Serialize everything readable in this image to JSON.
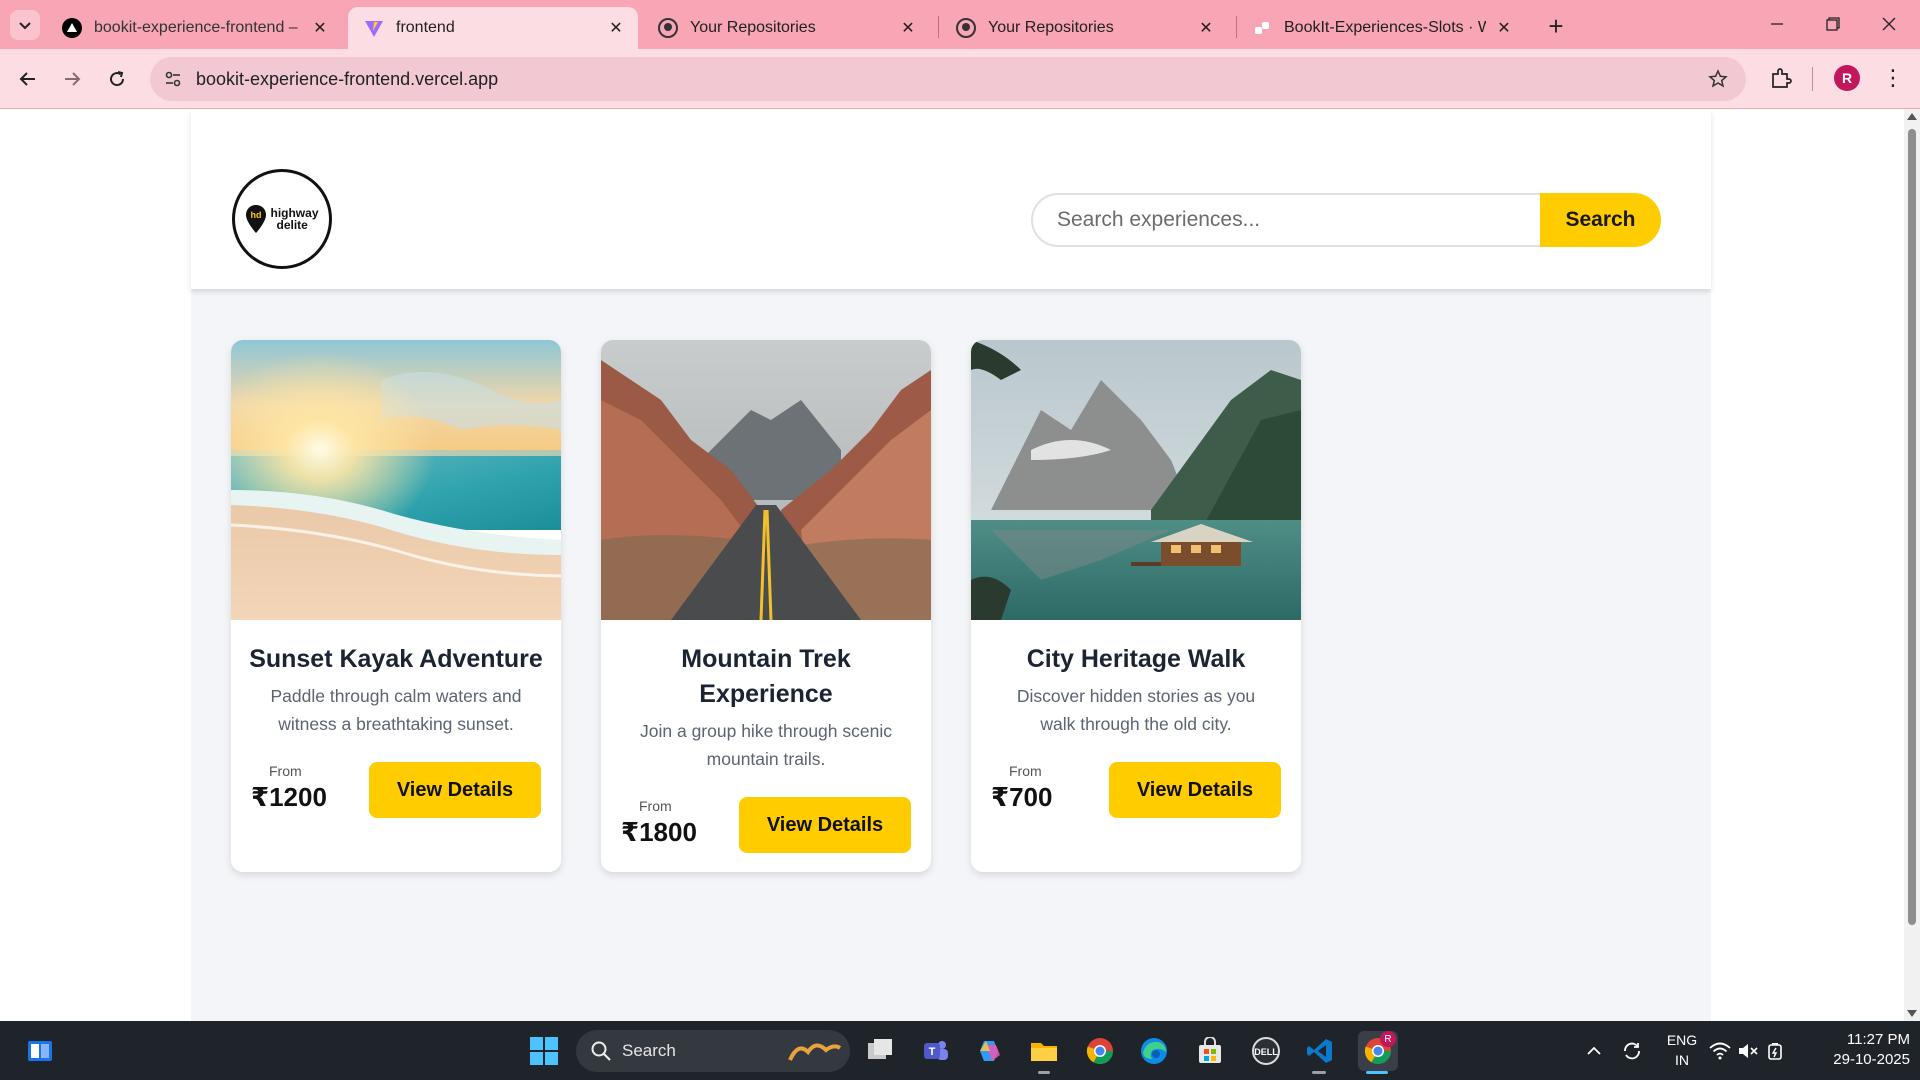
{
  "browser": {
    "tabs": [
      {
        "title": "bookit-experience-frontend – D",
        "favicon": "vercel-triangle-icon",
        "active": false
      },
      {
        "title": "frontend",
        "favicon": "vite-icon",
        "active": true
      },
      {
        "title": "Your Repositories",
        "favicon": "github-icon",
        "active": false
      },
      {
        "title": "Your Repositories",
        "favicon": "github-icon",
        "active": false
      },
      {
        "title": "BookIt-Experiences-Slots · Web",
        "favicon": "link-icon",
        "active": false
      }
    ],
    "url": "bookit-experience-frontend.vercel.app",
    "profile_initial": "R",
    "colors": {
      "tabbar": "#f8a6b6",
      "toolbar": "#fcdde4",
      "omnibox": "#f2c9d2"
    }
  },
  "site": {
    "logo": {
      "line1": "highway",
      "line2": "delite",
      "mark": "hd"
    },
    "search": {
      "placeholder": "Search experiences...",
      "button_label": "Search"
    },
    "accent": "#ffcc00",
    "experiences": [
      {
        "title": "Sunset Kayak Adventure",
        "description": "Paddle through calm waters and witness a breathtaking sunset.",
        "from_label": "From",
        "price": "₹1200",
        "button_label": "View Details",
        "image": "beach-sunset"
      },
      {
        "title": "Mountain Trek Experience",
        "description": "Join a group hike through scenic mountain trails.",
        "from_label": "From",
        "price": "₹1800",
        "button_label": "View Details",
        "image": "canyon-road"
      },
      {
        "title": "City Heritage Walk",
        "description": "Discover hidden stories as you walk through the old city.",
        "from_label": "From",
        "price": "₹700",
        "button_label": "View Details",
        "image": "mountain-lake-cabin"
      }
    ]
  },
  "taskbar": {
    "search_label": "Search",
    "language": "ENG",
    "region": "IN",
    "time": "11:27 PM",
    "date": "29-10-2025",
    "chrome_badge": "R"
  }
}
